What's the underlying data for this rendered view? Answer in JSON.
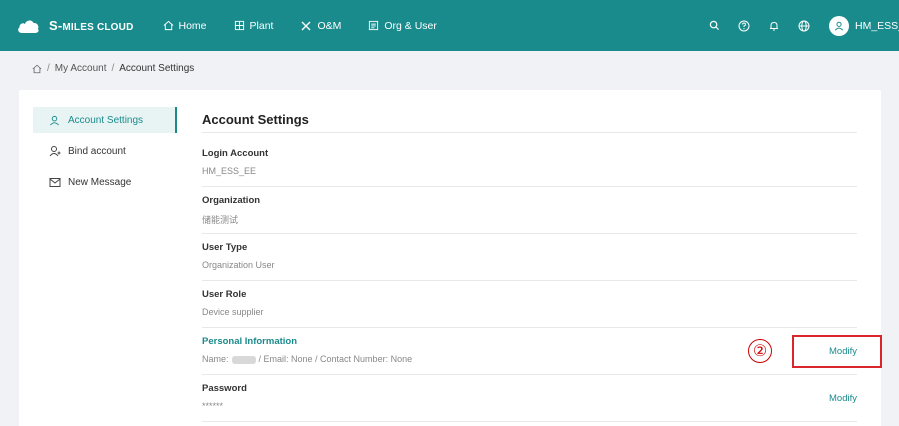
{
  "header": {
    "brand_prefix": "S-",
    "brand_rest": "miles Cloud",
    "nav": [
      {
        "label": "Home",
        "icon": "home-icon"
      },
      {
        "label": "Plant",
        "icon": "plant-icon"
      },
      {
        "label": "O&M",
        "icon": "tools-icon"
      },
      {
        "label": "Org & User",
        "icon": "org-icon"
      }
    ],
    "username": "HM_ESS_EE"
  },
  "breadcrumb": {
    "items": [
      "My Account",
      "Account Settings"
    ]
  },
  "menu": {
    "items": [
      {
        "label": "Account Settings",
        "icon": "user-icon",
        "active": true
      },
      {
        "label": "Bind account",
        "icon": "bind-user-icon",
        "active": false
      },
      {
        "label": "New Message",
        "icon": "mail-icon",
        "active": false
      }
    ]
  },
  "content": {
    "title": "Account Settings",
    "fields": [
      {
        "label": "Login Account",
        "value": "HM_ESS_EE"
      },
      {
        "label": "Organization",
        "value": "储能测试"
      },
      {
        "label": "User Type",
        "value": "Organization User"
      },
      {
        "label": "User Role",
        "value": "Device supplier"
      }
    ],
    "personal": {
      "label": "Personal Information",
      "name_prefix": "Name:",
      "rest": "/ Email: None / Contact Number: None",
      "modify": "Modify"
    },
    "password": {
      "label": "Password",
      "value": "******",
      "modify": "Modify"
    }
  },
  "annotation": {
    "marker": "②"
  },
  "colors": {
    "brand": "#1a8b8c",
    "annotation": "#d9262a"
  }
}
